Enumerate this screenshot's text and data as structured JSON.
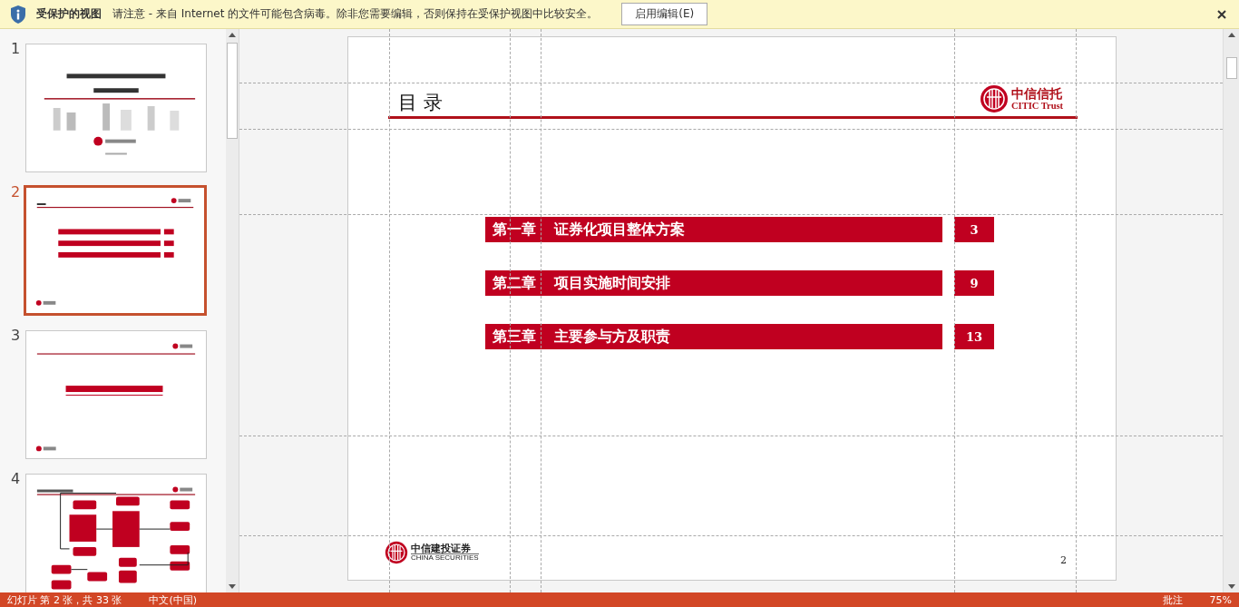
{
  "protected_view_bar": {
    "title": "受保护的视图",
    "message": "请注意 - 来自 Internet 的文件可能包含病毒。除非您需要编辑，否则保持在受保护视图中比较安全。",
    "button": "启用编辑(E)"
  },
  "thumbnails": [
    {
      "number": "1",
      "selected": false,
      "kind": "title"
    },
    {
      "number": "2",
      "selected": true,
      "kind": "toc"
    },
    {
      "number": "3",
      "selected": false,
      "kind": "section"
    },
    {
      "number": "4",
      "selected": false,
      "kind": "diagram"
    }
  ],
  "slide": {
    "title": "目 录",
    "top_logo": {
      "name": "中信信托",
      "subtitle": "CITIC Trust"
    },
    "chapters": [
      {
        "label": "第一章",
        "title": "证券化项目整体方案",
        "page": "3"
      },
      {
        "label": "第二章",
        "title": "项目实施时间安排",
        "page": "9"
      },
      {
        "label": "第三章",
        "title": "主要参与方及职责",
        "page": "13"
      }
    ],
    "footer_logo": {
      "name": "中信建投证券",
      "subtitle": "CHINA SECURITIES"
    },
    "page_number": "2"
  },
  "status_bar": {
    "slide_info": "幻灯片 第 2 张，共 33 张",
    "language": "中文(中国)",
    "notes": "批注",
    "zoom": "75%"
  }
}
